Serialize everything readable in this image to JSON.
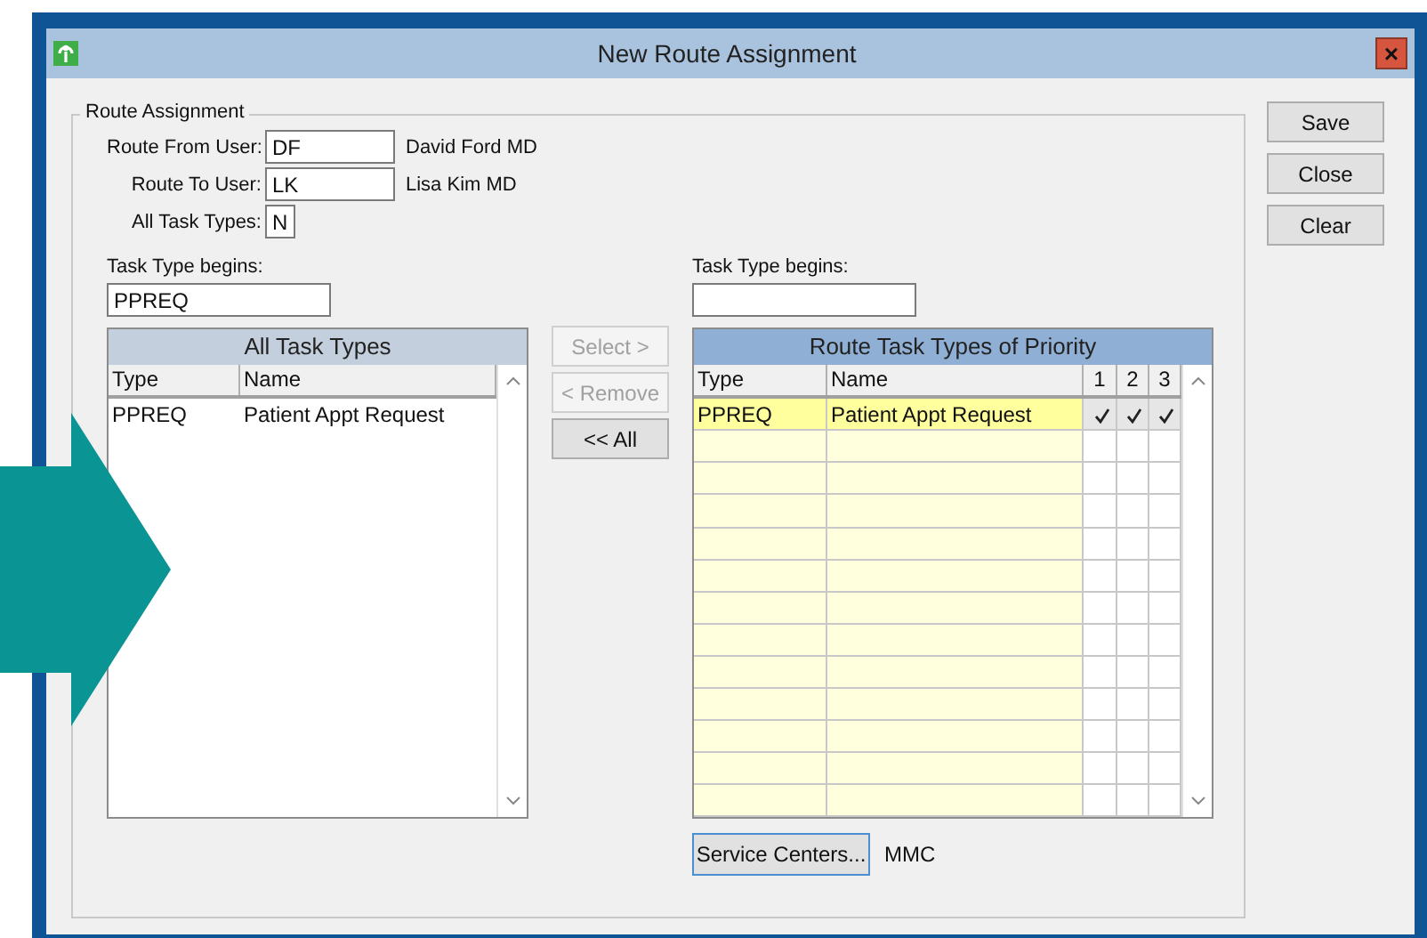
{
  "window": {
    "title": "New Route Assignment",
    "close": "×"
  },
  "group": {
    "title": "Route Assignment"
  },
  "user_fields": [
    {
      "label": "Route From User:",
      "value": "DF",
      "name": "David Ford MD",
      "kind": "wide"
    },
    {
      "label": "Route To User:",
      "value": "LK",
      "name": "Lisa Kim MD",
      "kind": "wide"
    },
    {
      "label": "All Task Types:",
      "value": "N",
      "kind": "narrow"
    }
  ],
  "left_filter": {
    "label": "Task Type begins:",
    "value": "PPREQ"
  },
  "right_filter": {
    "label": "Task Type begins:"
  },
  "all_task_types": {
    "title": "All Task Types",
    "columns": [
      "Type",
      "Name"
    ],
    "rows": [
      {
        "type": "PPREQ",
        "name": "Patient Appt Request"
      }
    ]
  },
  "move_buttons": [
    {
      "label": "Select >",
      "disabled": true
    },
    {
      "label": "< Remove",
      "disabled": true
    },
    {
      "label": "<< All",
      "disabled": false
    }
  ],
  "route_task_types": {
    "title": "Route Task Types of Priority",
    "columns": [
      "Type",
      "Name",
      "1",
      "2",
      "3"
    ],
    "rows": [
      {
        "type": "PPREQ",
        "name": "Patient Appt Request",
        "priorities": [
          true,
          true,
          true
        ]
      }
    ]
  },
  "service_centers": {
    "button": "Service Centers...",
    "value": "MMC"
  },
  "side_buttons": [
    "Save",
    "Close",
    "Clear"
  ]
}
